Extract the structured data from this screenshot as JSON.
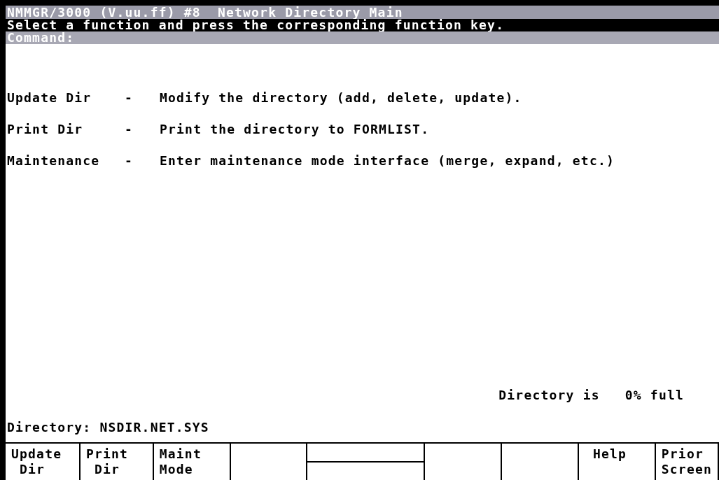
{
  "title": "NMMGR/3000 (V.uu.ff) #8  Network Directory Main",
  "prompt": "Select a function and press the corresponding function key.",
  "command": {
    "label": "Command:"
  },
  "menu": [
    {
      "name": "Update Dir",
      "separator": "-",
      "description": "Modify the directory (add, delete, update)."
    },
    {
      "name": "Print Dir",
      "separator": "-",
      "description": "Print the directory to FORMLIST."
    },
    {
      "name": "Maintenance",
      "separator": "-",
      "description": "Enter maintenance mode interface (merge, expand, etc.)"
    }
  ],
  "status": {
    "label": "Directory is",
    "value": "0% full"
  },
  "directory": "Directory: NSDIR.NET.SYS",
  "function_keys": [
    {
      "kind": "label",
      "lines": [
        "Update",
        " Dir"
      ]
    },
    {
      "kind": "label",
      "lines": [
        "Print",
        " Dir"
      ]
    },
    {
      "kind": "label",
      "lines": [
        "Maint",
        "Mode"
      ]
    },
    {
      "kind": "blank"
    },
    {
      "kind": "split"
    },
    {
      "kind": "blank"
    },
    {
      "kind": "blank"
    },
    {
      "kind": "label",
      "lines": [
        " Help"
      ]
    },
    {
      "kind": "label",
      "lines": [
        "Prior",
        "Screen"
      ]
    }
  ]
}
